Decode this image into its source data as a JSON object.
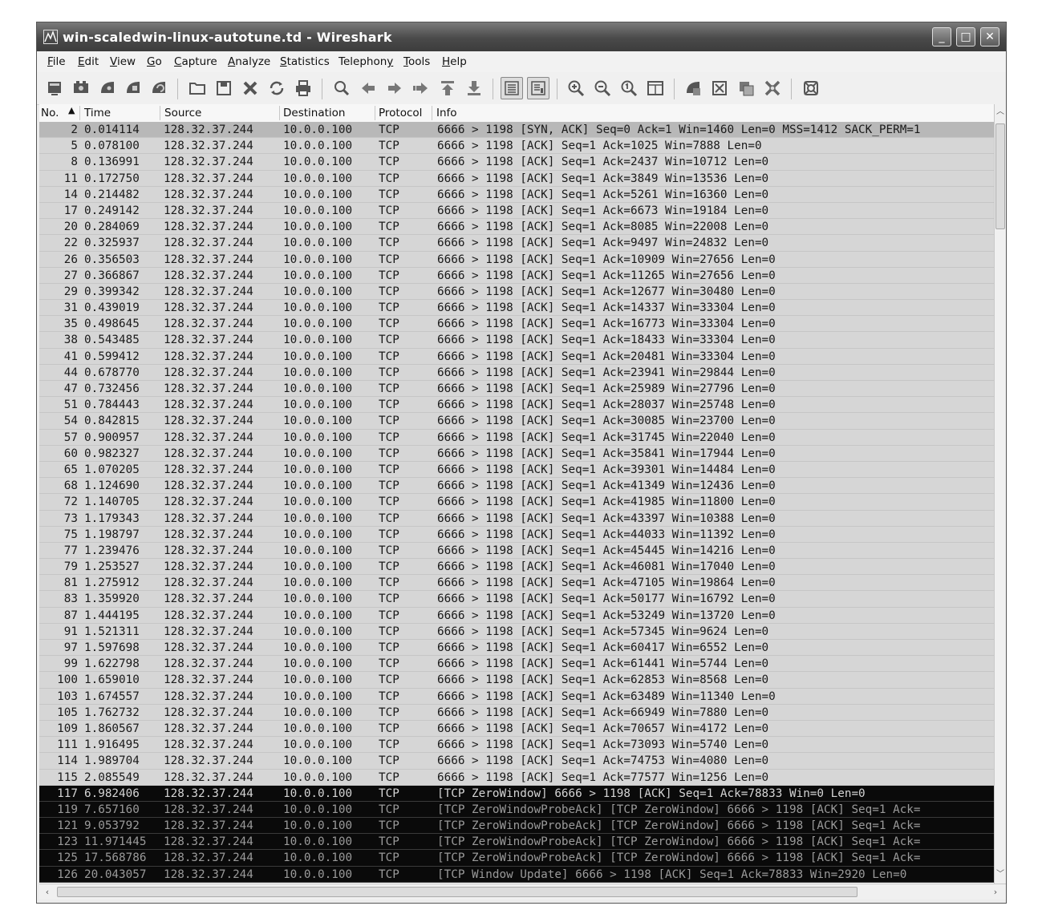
{
  "window": {
    "title": "win-scaledwin-linux-autotune.td - Wireshark",
    "minimize_glyph": "_",
    "maximize_glyph": "□",
    "close_glyph": "✕"
  },
  "menu": [
    {
      "pre": "",
      "ul": "F",
      "post": "ile"
    },
    {
      "pre": "",
      "ul": "E",
      "post": "dit"
    },
    {
      "pre": "",
      "ul": "V",
      "post": "iew"
    },
    {
      "pre": "",
      "ul": "G",
      "post": "o"
    },
    {
      "pre": "",
      "ul": "C",
      "post": "apture"
    },
    {
      "pre": "",
      "ul": "A",
      "post": "nalyze"
    },
    {
      "pre": "",
      "ul": "S",
      "post": "tatistics"
    },
    {
      "pre": "Telephon",
      "ul": "y",
      "post": ""
    },
    {
      "pre": "",
      "ul": "T",
      "post": "ools"
    },
    {
      "pre": "",
      "ul": "H",
      "post": "elp"
    }
  ],
  "toolbar_icons": [
    "interfaces-icon",
    "capture-options-icon",
    "start-capture-icon",
    "stop-capture-icon",
    "restart-capture-icon",
    "open-file-icon",
    "save-file-icon",
    "close-file-icon",
    "reload-icon",
    "print-icon",
    "find-packet-icon",
    "go-back-icon",
    "go-forward-icon",
    "go-to-packet-icon",
    "go-first-icon",
    "go-last-icon",
    "colorize-icon",
    "auto-scroll-icon",
    "zoom-in-icon",
    "zoom-out-icon",
    "normal-size-icon",
    "resize-columns-icon",
    "capture-filters-icon",
    "display-filters-icon",
    "coloring-rules-icon",
    "preferences-icon",
    "help-icon"
  ],
  "columns": {
    "no": "No.",
    "time": "Time",
    "source": "Source",
    "destination": "Destination",
    "protocol": "Protocol",
    "info": "Info"
  },
  "packets": [
    {
      "no": "2",
      "time": "0.014114",
      "src": "128.32.37.244",
      "dst": "10.0.0.100",
      "proto": "TCP",
      "info": "6666 > 1198 [SYN, ACK] Seq=0 Ack=1 Win=1460 Len=0 MSS=1412 SACK_PERM=1"
    },
    {
      "no": "5",
      "time": "0.078100",
      "src": "128.32.37.244",
      "dst": "10.0.0.100",
      "proto": "TCP",
      "info": "6666 > 1198 [ACK] Seq=1 Ack=1025 Win=7888 Len=0"
    },
    {
      "no": "8",
      "time": "0.136991",
      "src": "128.32.37.244",
      "dst": "10.0.0.100",
      "proto": "TCP",
      "info": "6666 > 1198 [ACK] Seq=1 Ack=2437 Win=10712 Len=0"
    },
    {
      "no": "11",
      "time": "0.172750",
      "src": "128.32.37.244",
      "dst": "10.0.0.100",
      "proto": "TCP",
      "info": "6666 > 1198 [ACK] Seq=1 Ack=3849 Win=13536 Len=0"
    },
    {
      "no": "14",
      "time": "0.214482",
      "src": "128.32.37.244",
      "dst": "10.0.0.100",
      "proto": "TCP",
      "info": "6666 > 1198 [ACK] Seq=1 Ack=5261 Win=16360 Len=0"
    },
    {
      "no": "17",
      "time": "0.249142",
      "src": "128.32.37.244",
      "dst": "10.0.0.100",
      "proto": "TCP",
      "info": "6666 > 1198 [ACK] Seq=1 Ack=6673 Win=19184 Len=0"
    },
    {
      "no": "20",
      "time": "0.284069",
      "src": "128.32.37.244",
      "dst": "10.0.0.100",
      "proto": "TCP",
      "info": "6666 > 1198 [ACK] Seq=1 Ack=8085 Win=22008 Len=0"
    },
    {
      "no": "22",
      "time": "0.325937",
      "src": "128.32.37.244",
      "dst": "10.0.0.100",
      "proto": "TCP",
      "info": "6666 > 1198 [ACK] Seq=1 Ack=9497 Win=24832 Len=0"
    },
    {
      "no": "26",
      "time": "0.356503",
      "src": "128.32.37.244",
      "dst": "10.0.0.100",
      "proto": "TCP",
      "info": "6666 > 1198 [ACK] Seq=1 Ack=10909 Win=27656 Len=0"
    },
    {
      "no": "27",
      "time": "0.366867",
      "src": "128.32.37.244",
      "dst": "10.0.0.100",
      "proto": "TCP",
      "info": "6666 > 1198 [ACK] Seq=1 Ack=11265 Win=27656 Len=0"
    },
    {
      "no": "29",
      "time": "0.399342",
      "src": "128.32.37.244",
      "dst": "10.0.0.100",
      "proto": "TCP",
      "info": "6666 > 1198 [ACK] Seq=1 Ack=12677 Win=30480 Len=0"
    },
    {
      "no": "31",
      "time": "0.439019",
      "src": "128.32.37.244",
      "dst": "10.0.0.100",
      "proto": "TCP",
      "info": "6666 > 1198 [ACK] Seq=1 Ack=14337 Win=33304 Len=0"
    },
    {
      "no": "35",
      "time": "0.498645",
      "src": "128.32.37.244",
      "dst": "10.0.0.100",
      "proto": "TCP",
      "info": "6666 > 1198 [ACK] Seq=1 Ack=16773 Win=33304 Len=0"
    },
    {
      "no": "38",
      "time": "0.543485",
      "src": "128.32.37.244",
      "dst": "10.0.0.100",
      "proto": "TCP",
      "info": "6666 > 1198 [ACK] Seq=1 Ack=18433 Win=33304 Len=0"
    },
    {
      "no": "41",
      "time": "0.599412",
      "src": "128.32.37.244",
      "dst": "10.0.0.100",
      "proto": "TCP",
      "info": "6666 > 1198 [ACK] Seq=1 Ack=20481 Win=33304 Len=0"
    },
    {
      "no": "44",
      "time": "0.678770",
      "src": "128.32.37.244",
      "dst": "10.0.0.100",
      "proto": "TCP",
      "info": "6666 > 1198 [ACK] Seq=1 Ack=23941 Win=29844 Len=0"
    },
    {
      "no": "47",
      "time": "0.732456",
      "src": "128.32.37.244",
      "dst": "10.0.0.100",
      "proto": "TCP",
      "info": "6666 > 1198 [ACK] Seq=1 Ack=25989 Win=27796 Len=0"
    },
    {
      "no": "51",
      "time": "0.784443",
      "src": "128.32.37.244",
      "dst": "10.0.0.100",
      "proto": "TCP",
      "info": "6666 > 1198 [ACK] Seq=1 Ack=28037 Win=25748 Len=0"
    },
    {
      "no": "54",
      "time": "0.842815",
      "src": "128.32.37.244",
      "dst": "10.0.0.100",
      "proto": "TCP",
      "info": "6666 > 1198 [ACK] Seq=1 Ack=30085 Win=23700 Len=0"
    },
    {
      "no": "57",
      "time": "0.900957",
      "src": "128.32.37.244",
      "dst": "10.0.0.100",
      "proto": "TCP",
      "info": "6666 > 1198 [ACK] Seq=1 Ack=31745 Win=22040 Len=0"
    },
    {
      "no": "60",
      "time": "0.982327",
      "src": "128.32.37.244",
      "dst": "10.0.0.100",
      "proto": "TCP",
      "info": "6666 > 1198 [ACK] Seq=1 Ack=35841 Win=17944 Len=0"
    },
    {
      "no": "65",
      "time": "1.070205",
      "src": "128.32.37.244",
      "dst": "10.0.0.100",
      "proto": "TCP",
      "info": "6666 > 1198 [ACK] Seq=1 Ack=39301 Win=14484 Len=0"
    },
    {
      "no": "68",
      "time": "1.124690",
      "src": "128.32.37.244",
      "dst": "10.0.0.100",
      "proto": "TCP",
      "info": "6666 > 1198 [ACK] Seq=1 Ack=41349 Win=12436 Len=0"
    },
    {
      "no": "72",
      "time": "1.140705",
      "src": "128.32.37.244",
      "dst": "10.0.0.100",
      "proto": "TCP",
      "info": "6666 > 1198 [ACK] Seq=1 Ack=41985 Win=11800 Len=0"
    },
    {
      "no": "73",
      "time": "1.179343",
      "src": "128.32.37.244",
      "dst": "10.0.0.100",
      "proto": "TCP",
      "info": "6666 > 1198 [ACK] Seq=1 Ack=43397 Win=10388 Len=0"
    },
    {
      "no": "75",
      "time": "1.198797",
      "src": "128.32.37.244",
      "dst": "10.0.0.100",
      "proto": "TCP",
      "info": "6666 > 1198 [ACK] Seq=1 Ack=44033 Win=11392 Len=0"
    },
    {
      "no": "77",
      "time": "1.239476",
      "src": "128.32.37.244",
      "dst": "10.0.0.100",
      "proto": "TCP",
      "info": "6666 > 1198 [ACK] Seq=1 Ack=45445 Win=14216 Len=0"
    },
    {
      "no": "79",
      "time": "1.253527",
      "src": "128.32.37.244",
      "dst": "10.0.0.100",
      "proto": "TCP",
      "info": "6666 > 1198 [ACK] Seq=1 Ack=46081 Win=17040 Len=0"
    },
    {
      "no": "81",
      "time": "1.275912",
      "src": "128.32.37.244",
      "dst": "10.0.0.100",
      "proto": "TCP",
      "info": "6666 > 1198 [ACK] Seq=1 Ack=47105 Win=19864 Len=0"
    },
    {
      "no": "83",
      "time": "1.359920",
      "src": "128.32.37.244",
      "dst": "10.0.0.100",
      "proto": "TCP",
      "info": "6666 > 1198 [ACK] Seq=1 Ack=50177 Win=16792 Len=0"
    },
    {
      "no": "87",
      "time": "1.444195",
      "src": "128.32.37.244",
      "dst": "10.0.0.100",
      "proto": "TCP",
      "info": "6666 > 1198 [ACK] Seq=1 Ack=53249 Win=13720 Len=0"
    },
    {
      "no": "91",
      "time": "1.521311",
      "src": "128.32.37.244",
      "dst": "10.0.0.100",
      "proto": "TCP",
      "info": "6666 > 1198 [ACK] Seq=1 Ack=57345 Win=9624 Len=0"
    },
    {
      "no": "97",
      "time": "1.597698",
      "src": "128.32.37.244",
      "dst": "10.0.0.100",
      "proto": "TCP",
      "info": "6666 > 1198 [ACK] Seq=1 Ack=60417 Win=6552 Len=0"
    },
    {
      "no": "99",
      "time": "1.622798",
      "src": "128.32.37.244",
      "dst": "10.0.0.100",
      "proto": "TCP",
      "info": "6666 > 1198 [ACK] Seq=1 Ack=61441 Win=5744 Len=0"
    },
    {
      "no": "100",
      "time": "1.659010",
      "src": "128.32.37.244",
      "dst": "10.0.0.100",
      "proto": "TCP",
      "info": "6666 > 1198 [ACK] Seq=1 Ack=62853 Win=8568 Len=0"
    },
    {
      "no": "103",
      "time": "1.674557",
      "src": "128.32.37.244",
      "dst": "10.0.0.100",
      "proto": "TCP",
      "info": "6666 > 1198 [ACK] Seq=1 Ack=63489 Win=11340 Len=0"
    },
    {
      "no": "105",
      "time": "1.762732",
      "src": "128.32.37.244",
      "dst": "10.0.0.100",
      "proto": "TCP",
      "info": "6666 > 1198 [ACK] Seq=1 Ack=66949 Win=7880 Len=0"
    },
    {
      "no": "109",
      "time": "1.860567",
      "src": "128.32.37.244",
      "dst": "10.0.0.100",
      "proto": "TCP",
      "info": "6666 > 1198 [ACK] Seq=1 Ack=70657 Win=4172 Len=0"
    },
    {
      "no": "111",
      "time": "1.916495",
      "src": "128.32.37.244",
      "dst": "10.0.0.100",
      "proto": "TCP",
      "info": "6666 > 1198 [ACK] Seq=1 Ack=73093 Win=5740 Len=0"
    },
    {
      "no": "114",
      "time": "1.989704",
      "src": "128.32.37.244",
      "dst": "10.0.0.100",
      "proto": "TCP",
      "info": "6666 > 1198 [ACK] Seq=1 Ack=74753 Win=4080 Len=0"
    },
    {
      "no": "115",
      "time": "2.085549",
      "src": "128.32.37.244",
      "dst": "10.0.0.100",
      "proto": "TCP",
      "info": "6666 > 1198 [ACK] Seq=1 Ack=77577 Win=1256 Len=0"
    },
    {
      "no": "117",
      "time": "6.982406",
      "src": "128.32.37.244",
      "dst": "10.0.0.100",
      "proto": "TCP",
      "info": "[TCP ZeroWindow] 6666 > 1198 [ACK] Seq=1 Ack=78833 Win=0 Len=0"
    },
    {
      "no": "119",
      "time": "7.657160",
      "src": "128.32.37.244",
      "dst": "10.0.0.100",
      "proto": "TCP",
      "info": "[TCP ZeroWindowProbeAck] [TCP ZeroWindow] 6666 > 1198 [ACK] Seq=1 Ack="
    },
    {
      "no": "121",
      "time": "9.053792",
      "src": "128.32.37.244",
      "dst": "10.0.0.100",
      "proto": "TCP",
      "info": "[TCP ZeroWindowProbeAck] [TCP ZeroWindow] 6666 > 1198 [ACK] Seq=1 Ack="
    },
    {
      "no": "123",
      "time": "11.971445",
      "src": "128.32.37.244",
      "dst": "10.0.0.100",
      "proto": "TCP",
      "info": "[TCP ZeroWindowProbeAck] [TCP ZeroWindow] 6666 > 1198 [ACK] Seq=1 Ack="
    },
    {
      "no": "125",
      "time": "17.568786",
      "src": "128.32.37.244",
      "dst": "10.0.0.100",
      "proto": "TCP",
      "info": "[TCP ZeroWindowProbeAck] [TCP ZeroWindow] 6666 > 1198 [ACK] Seq=1 Ack="
    },
    {
      "no": "126",
      "time": "20.043057",
      "src": "128.32.37.244",
      "dst": "10.0.0.100",
      "proto": "TCP",
      "info": "[TCP Window Update] 6666 > 1198 [ACK] Seq=1 Ack=78833 Win=2920 Len=0"
    }
  ],
  "row_styles": {
    "selected_row_no": "2",
    "dark_rows": [
      "117",
      "119",
      "121",
      "123",
      "125",
      "126"
    ],
    "dim_rows": [
      "119",
      "121",
      "123",
      "125",
      "126"
    ]
  },
  "colors": {
    "normal_row": "#d6d6d6",
    "selected_row": "#b8b8b8",
    "dark_row": "#0a0a0a",
    "titlebar": "#4a4a4a"
  }
}
